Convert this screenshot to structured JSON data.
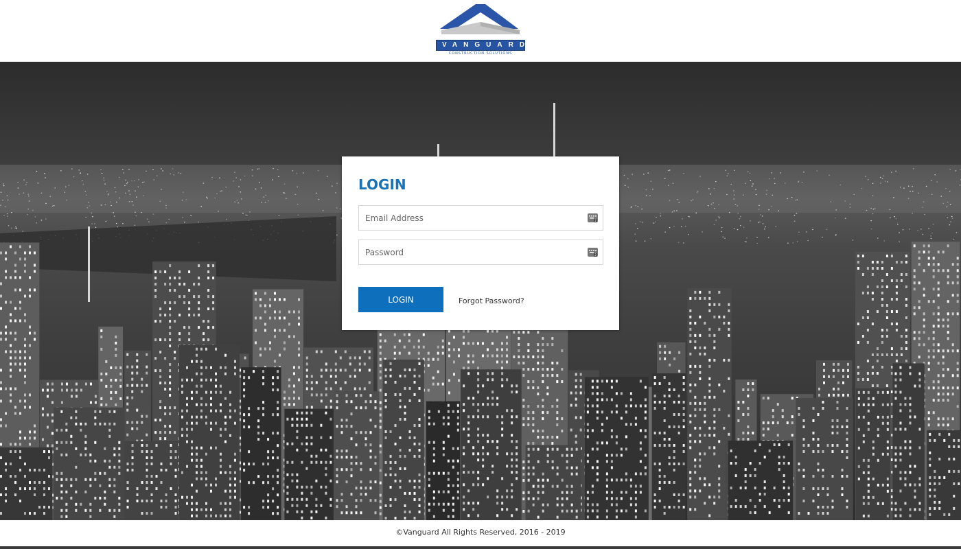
{
  "brand": {
    "name": "VANGUARD",
    "tagline": "CONSTRUCTION SOLUTIONS",
    "colors": {
      "primary": "#2753a3",
      "accent": "#0e6fbd",
      "title": "#1a72b8"
    }
  },
  "login": {
    "title": "LOGIN",
    "email": {
      "placeholder": "Email Address",
      "value": "",
      "icon": "keyboard-badge-icon"
    },
    "password": {
      "placeholder": "Password",
      "value": "",
      "icon": "keyboard-badge-icon"
    },
    "submit_label": "LOGIN",
    "forgot_label": "Forgot Password?"
  },
  "background": {
    "description_icon": "city-skyline-photo"
  },
  "footer": {
    "copyright": "©Vanguard All Rights Reserved, 2016 - 2019"
  }
}
